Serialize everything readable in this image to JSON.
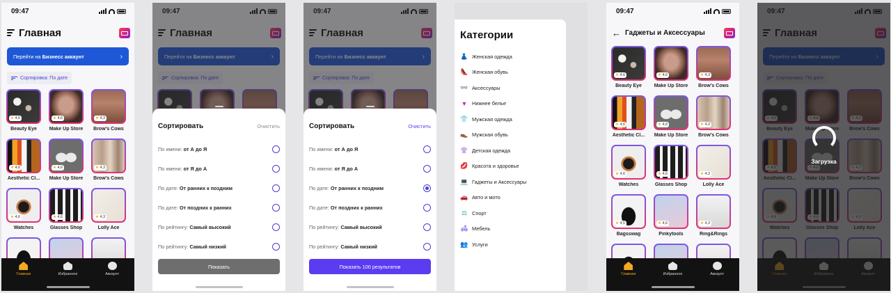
{
  "status": {
    "time": "09:47"
  },
  "home": {
    "title": "Главная",
    "business_prefix": "Перейти на",
    "business_bold": "Бизнесс аккаунт",
    "sort_chip": "Сортировка: По дате"
  },
  "products": [
    {
      "name": "Beauty Eye",
      "rating": "4,6"
    },
    {
      "name": "Make Up Store",
      "rating": "4,6"
    },
    {
      "name": "Brow's Cows",
      "rating": "4,3"
    },
    {
      "name": "Aesthetic Cl...",
      "rating": "4,6"
    },
    {
      "name": "Make Up Store",
      "rating": "4,6"
    },
    {
      "name": "Brow's Cows",
      "rating": "4,3"
    },
    {
      "name": "Watches",
      "rating": "4,6"
    },
    {
      "name": "Glasses Shop",
      "rating": "4,6"
    },
    {
      "name": "Lolly Ace",
      "rating": "4,3"
    },
    {
      "name": "Bagsswag",
      "rating": "4,5"
    },
    {
      "name": "Pinkytools",
      "rating": "4,6"
    },
    {
      "name": "Ring&Rings",
      "rating": "4,3"
    }
  ],
  "tabs": {
    "home": "Главная",
    "favorites": "Избранное",
    "account": "Аккаунт"
  },
  "sort_sheet": {
    "title": "Сортировать",
    "clear": "Очистить",
    "options": [
      {
        "prefix": "По имени:",
        "value": "от А до Я"
      },
      {
        "prefix": "По имени:",
        "value": "от Я до А"
      },
      {
        "prefix": "По дате:",
        "value": "От ранних к поздним"
      },
      {
        "prefix": "По дате:",
        "value": "От поздних к ранних"
      },
      {
        "prefix": "По рейтингу:",
        "value": "Самый высокий"
      },
      {
        "prefix": "По рейтингу:",
        "value": "Самый низкий"
      }
    ],
    "show_button": "Показать",
    "show_results_button": "Показать 100 результатов",
    "selected_index_screen3": 2
  },
  "categories": {
    "title": "Категории",
    "items": [
      {
        "label": "Женская одежда",
        "icon": "dress-icon"
      },
      {
        "label": "Женская обувь",
        "icon": "heel-icon"
      },
      {
        "label": "Аксессуары",
        "icon": "glasses-icon"
      },
      {
        "label": "Нижнее белье",
        "icon": "underwear-icon"
      },
      {
        "label": "Мужская одежда",
        "icon": "shirt-icon"
      },
      {
        "label": "Мужская обувь",
        "icon": "shoe-icon"
      },
      {
        "label": "Детская одежда",
        "icon": "kids-icon"
      },
      {
        "label": "Красота и здоровье",
        "icon": "lips-icon"
      },
      {
        "label": "Гаджеты и Аксессуары",
        "icon": "laptop-icon"
      },
      {
        "label": "Авто и мото",
        "icon": "car-icon"
      },
      {
        "label": "Спорт",
        "icon": "dumbbell-icon"
      },
      {
        "label": "Мебель",
        "icon": "sofa-icon"
      },
      {
        "label": "Услуги",
        "icon": "people-icon"
      }
    ]
  },
  "gadgets": {
    "title": "Гаджеты и Аксессуары"
  },
  "loading": {
    "label": "Загрузка"
  },
  "colors": {
    "accent": "#5b3cf0",
    "business": "#1f58d6",
    "tab_active": "#f4a91e"
  }
}
